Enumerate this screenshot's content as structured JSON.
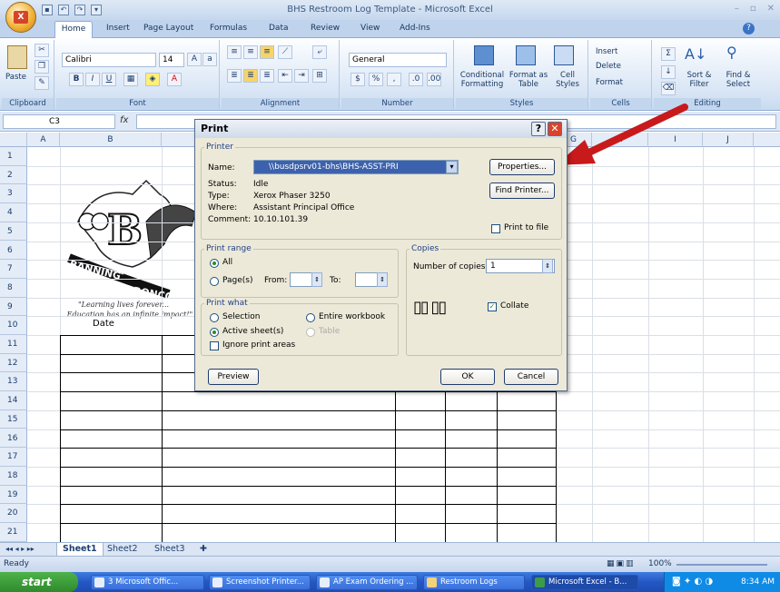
{
  "window": {
    "title": "BHS Restroom Log Template - Microsoft Excel",
    "office_button": "Office",
    "controls": [
      "–",
      "▫",
      "✕"
    ]
  },
  "tabs": [
    "Home",
    "Insert",
    "Page Layout",
    "Formulas",
    "Data",
    "Review",
    "View",
    "Add-Ins"
  ],
  "ribbon": {
    "clipboard": {
      "label": "Clipboard",
      "paste": "Paste"
    },
    "font": {
      "label": "Font",
      "name": "Calibri",
      "size": "14",
      "bold": "B",
      "italic": "I",
      "underline": "U"
    },
    "alignment": {
      "label": "Alignment"
    },
    "number": {
      "label": "Number",
      "format": "General",
      "currency": "$",
      "percent": "%",
      "comma": ","
    },
    "styles": {
      "label": "Styles",
      "conditional": "Conditional Formatting",
      "format_table": "Format as Table",
      "cell_styles": "Cell Styles"
    },
    "cells": {
      "label": "Cells",
      "insert": "Insert",
      "delete": "Delete",
      "format": "Format"
    },
    "editing": {
      "label": "Editing",
      "sort": "Sort & Filter",
      "find": "Find & Select"
    }
  },
  "formula_bar": {
    "name_box": "C3",
    "fx": "fx"
  },
  "columns": [
    "A",
    "B",
    "G",
    "H",
    "I",
    "J"
  ],
  "rows": [
    "1",
    "2",
    "3",
    "4",
    "5",
    "6",
    "7",
    "8",
    "9",
    "10",
    "11",
    "12",
    "13",
    "14",
    "15",
    "16",
    "17",
    "18",
    "19",
    "20",
    "21"
  ],
  "sheet": {
    "date_header": "Date",
    "motto_line1": "\"Learning lives forever...",
    "motto_line2": "...Education has an infinite impact!\"",
    "logo_words": [
      "BANNING",
      "BRONCOS"
    ]
  },
  "sheet_tabs": [
    "Sheet1",
    "Sheet2",
    "Sheet3"
  ],
  "status": {
    "ready": "Ready",
    "zoom": "100%"
  },
  "taskbar": {
    "start": "start",
    "items": [
      "3 Microsoft Offic...",
      "Screenshot Printer...",
      "AP Exam Ordering ...",
      "Restroom Logs",
      "Microsoft Excel - B..."
    ],
    "clock": "8:34 AM"
  },
  "dialog": {
    "title": "Print",
    "printer": {
      "legend": "Printer",
      "name_label": "Name:",
      "name_value": "\\\\busdpsrv01-bhs\\BHS-ASST-PRI",
      "status_label": "Status:",
      "status_value": "Idle",
      "type_label": "Type:",
      "type_value": "Xerox Phaser 3250",
      "where_label": "Where:",
      "where_value": "Assistant Principal Office",
      "comment_label": "Comment:",
      "comment_value": "10.10.101.39",
      "properties": "Properties...",
      "find_printer": "Find Printer...",
      "print_to_file": "Print to file"
    },
    "range": {
      "legend": "Print range",
      "all": "All",
      "pages": "Page(s)",
      "from": "From:",
      "to": "To:"
    },
    "what": {
      "legend": "Print what",
      "selection": "Selection",
      "entire": "Entire workbook",
      "active": "Active sheet(s)",
      "table": "Table",
      "ignore": "Ignore print areas"
    },
    "copies": {
      "legend": "Copies",
      "number_label": "Number of copies:",
      "number_value": "1",
      "collate": "Collate"
    },
    "preview": "Preview",
    "ok": "OK",
    "cancel": "Cancel",
    "help": "?",
    "close": "✕"
  }
}
